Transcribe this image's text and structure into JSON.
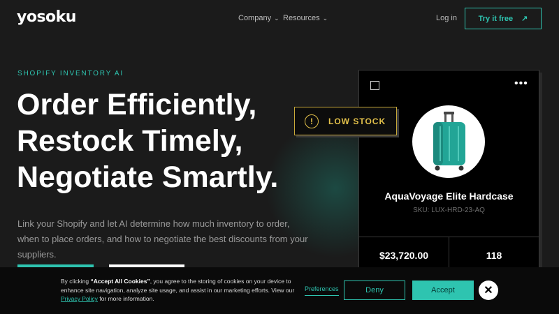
{
  "header": {
    "logo": "yosoku",
    "nav": [
      {
        "label": "Company",
        "icon": "chevron-down-icon"
      },
      {
        "label": "Resources",
        "icon": "chevron-down-icon"
      }
    ],
    "login_label": "Log in",
    "try_label": "Try it free",
    "try_icon": "arrow-up-right-icon"
  },
  "hero": {
    "eyebrow": "SHOPIFY INVENTORY AI",
    "headline_lines": [
      "Order Efficiently,",
      "Restock Timely,",
      "Negotiate Smartly."
    ],
    "subtext": "Link your Shopify and let AI determine how much inventory to order, when to place orders, and how to negotiate the best discounts from your suppliers."
  },
  "product_card": {
    "badge": "LOW STOCK",
    "badge_icon": "warning-icon",
    "name": "AquaVoyage Elite Hardcase",
    "sku": "SKU: LUX-HRD-23-AQ",
    "stats": [
      "$23,720.00",
      "118"
    ],
    "menu_icon": "more-dots-icon"
  },
  "cookie_banner": {
    "text_prefix": "By clicking ",
    "text_bold": "“Accept All Cookies”",
    "text_middle": ", you agree to the storing of cookies on your device to enhance site navigation, analyze site usage, and assist in our marketing efforts. View our ",
    "link": "Privacy Policy",
    "text_suffix": " for more information.",
    "preferences": "Preferences",
    "deny": "Deny",
    "accept": "Accept",
    "close_icon": "close-icon"
  },
  "colors": {
    "accent": "#2ec4b0",
    "warning": "#e2c04a",
    "background": "#1b1b1b"
  }
}
